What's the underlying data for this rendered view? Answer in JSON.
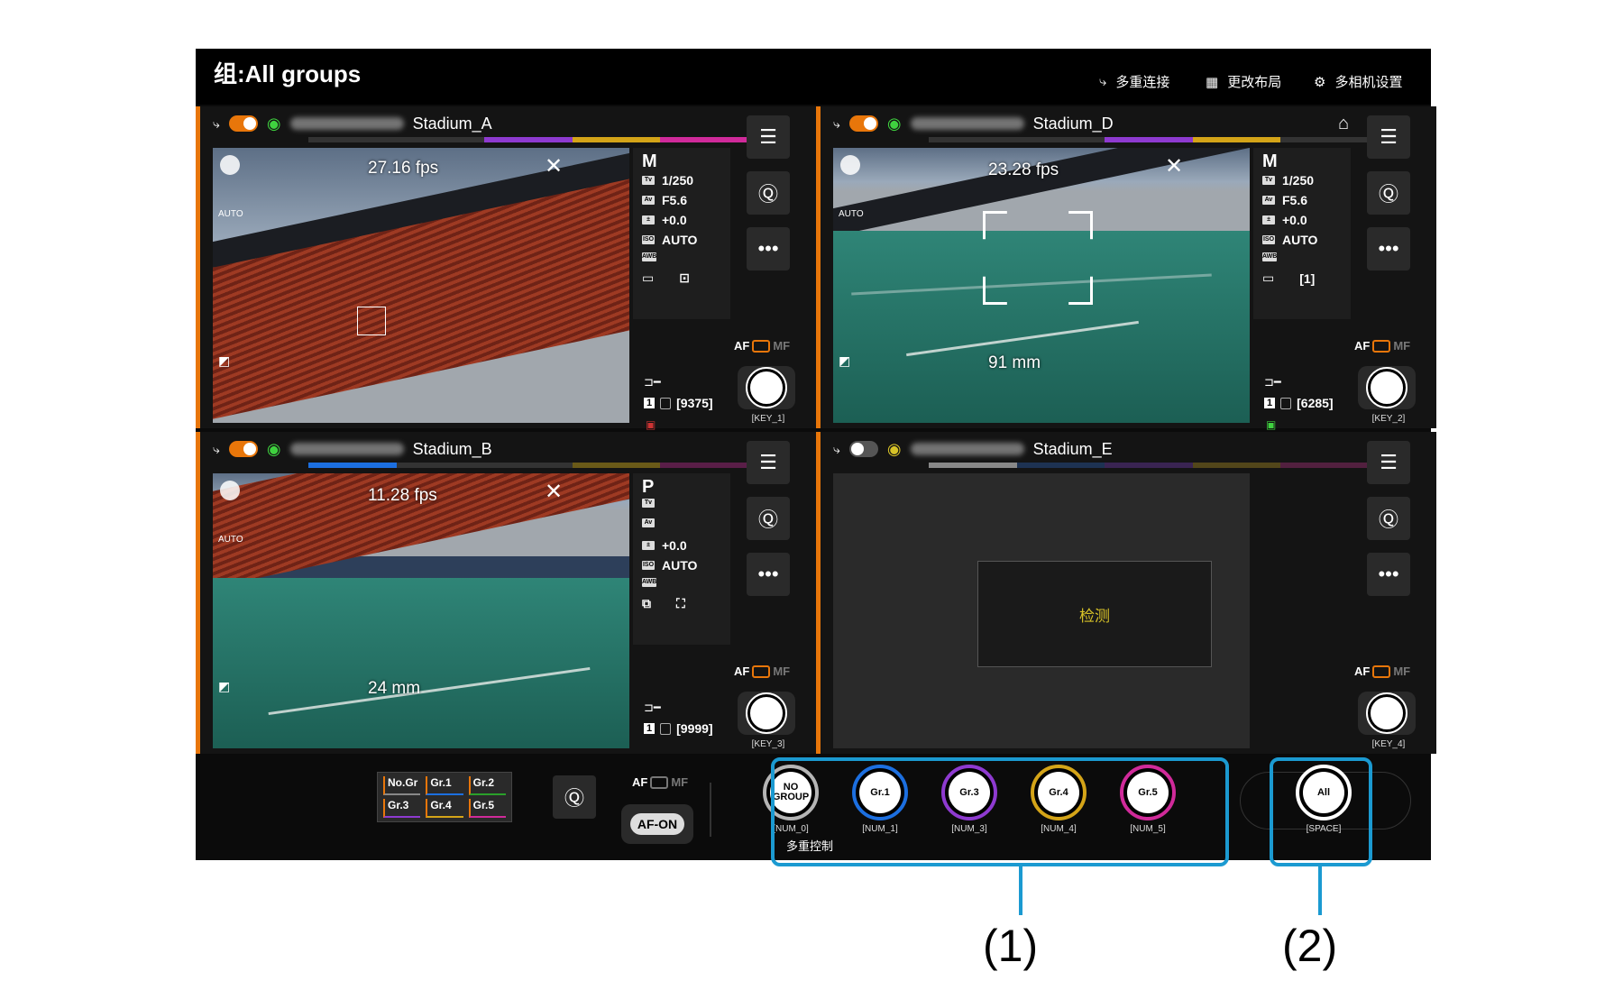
{
  "header": {
    "group_label": "组:All groups",
    "multi_connect": "多重连接",
    "change_layout": "更改布局",
    "multi_camera_settings": "多相机设置"
  },
  "cameras": [
    {
      "name": "Stadium_A",
      "fps": "27.16 fps",
      "mode": "M",
      "tv": "1/250",
      "av": "F5.6",
      "exp": "+0.0",
      "iso": "AUTO",
      "shots": "[9375]",
      "key": "[KEY_1]",
      "auto": "AUTO",
      "mm": ""
    },
    {
      "name": "Stadium_D",
      "fps": "23.28 fps",
      "mode": "M",
      "tv": "1/250",
      "av": "F5.6",
      "exp": "+0.0",
      "iso": "AUTO",
      "af_point": "[1]",
      "shots": "[6285]",
      "key": "[KEY_2]",
      "auto": "AUTO",
      "mm": "91 mm"
    },
    {
      "name": "Stadium_B",
      "fps": "11.28 fps",
      "mode": "P",
      "tv": "",
      "av": "",
      "exp": "+0.0",
      "iso": "AUTO",
      "shots": "[9999]",
      "key": "[KEY_3]",
      "auto": "AUTO",
      "mm": "24 mm"
    },
    {
      "name": "Stadium_E",
      "detect": "检测",
      "key": "[KEY_4]"
    }
  ],
  "common": {
    "af": "AF",
    "mf": "MF"
  },
  "bottom": {
    "groups_grid": [
      "No.Gr",
      "Gr.1",
      "Gr.2",
      "Gr.3",
      "Gr.4",
      "Gr.5"
    ],
    "af_on": "AF-ON",
    "group_buttons": [
      {
        "label": "NO GROUP",
        "key": "[NUM_0]",
        "color": "#b5b5b5"
      },
      {
        "label": "Gr.1",
        "key": "[NUM_1]",
        "color": "#1c6fe0"
      },
      {
        "label": "Gr.3",
        "key": "[NUM_3]",
        "color": "#8e3ad0"
      },
      {
        "label": "Gr.4",
        "key": "[NUM_4]",
        "color": "#d4a418"
      },
      {
        "label": "Gr.5",
        "key": "[NUM_5]",
        "color": "#d02a9a"
      }
    ],
    "multi_control": "多重控制",
    "all_label": "All",
    "all_key": "[SPACE]"
  },
  "callouts": {
    "c1": "(1)",
    "c2": "(2)"
  },
  "colors": {
    "accent": "#e8760a",
    "callout": "#1b9ad1"
  }
}
